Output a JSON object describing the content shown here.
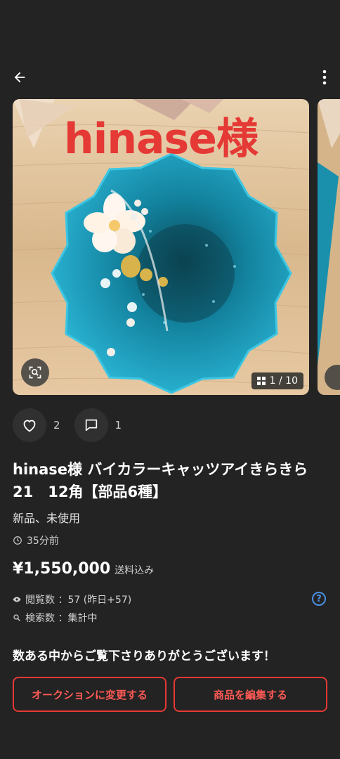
{
  "header": {
    "back_icon": "arrow-left-icon",
    "more_icon": "more-vert-icon"
  },
  "gallery": {
    "overlay_text": "hinase様",
    "counter": "1 / 10",
    "lens_icon": "image-search-icon",
    "grid_icon": "grid-icon",
    "colors": {
      "resin_primary": "#1aa3c4",
      "wood": "#e2c29a",
      "overlay": "#e53935"
    }
  },
  "actions": {
    "like_count": "2",
    "comment_count": "1"
  },
  "product": {
    "title": "hinase様 バイカラーキャッツアイきらきら　21　12角【部品6種】",
    "condition": "新品、未使用",
    "posted_ago": "35分前",
    "price": "¥1,550,000",
    "shipping": "送料込み"
  },
  "stats": {
    "views": "閲覧数 ：57 (昨日+57)",
    "searches": "検索数 ：集計中",
    "help": "?"
  },
  "message": "数ある中からご覧下さりありがとうございます！",
  "buttons": {
    "auction": "オークションに変更する",
    "edit": "商品を編集する"
  }
}
